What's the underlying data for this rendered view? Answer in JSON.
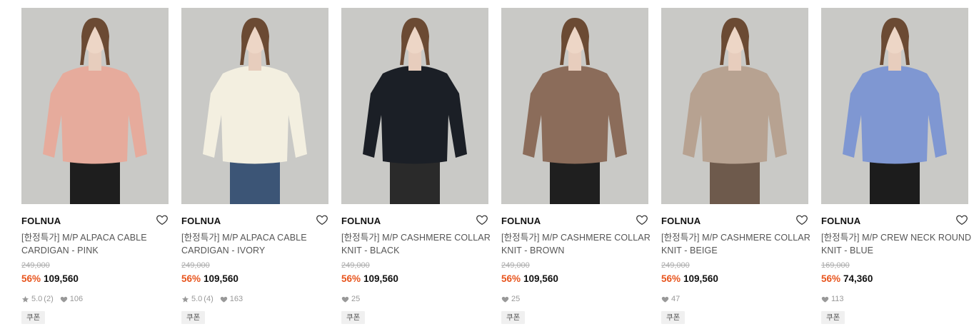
{
  "colors": {
    "discount": "#e8551e",
    "thumb_bg": "#c9c9c6"
  },
  "products": [
    {
      "brand": "FOLNUA",
      "name": "[한정특가] M/P ALPACA CABLE CARDIGAN - PINK",
      "original_price": "249,000",
      "discount": "56%",
      "price": "109,560",
      "rating": "5.0",
      "review_count": "(2)",
      "likes": "106",
      "coupon": "쿠폰",
      "garment_color": "#e6ab9c",
      "bottom_color": "#1e1e1e",
      "icons": [
        "heart-outline-icon",
        "star-icon",
        "heart-icon"
      ]
    },
    {
      "brand": "FOLNUA",
      "name": "[한정특가] M/P ALPACA CABLE CARDIGAN - IVORY",
      "original_price": "249,000",
      "discount": "56%",
      "price": "109,560",
      "rating": "5.0",
      "review_count": "(4)",
      "likes": "163",
      "coupon": "쿠폰",
      "garment_color": "#f3efe0",
      "bottom_color": "#3c5576",
      "icons": [
        "heart-outline-icon",
        "star-icon",
        "heart-icon"
      ]
    },
    {
      "brand": "FOLNUA",
      "name": "[한정특가] M/P CASHMERE COLLAR KNIT - BLACK",
      "original_price": "249,000",
      "discount": "56%",
      "price": "109,560",
      "rating": "",
      "review_count": "",
      "likes": "25",
      "coupon": "쿠폰",
      "garment_color": "#1b1f26",
      "bottom_color": "#2a2a2a",
      "icons": [
        "heart-outline-icon",
        "heart-icon"
      ]
    },
    {
      "brand": "FOLNUA",
      "name": "[한정특가] M/P CASHMERE COLLAR KNIT - BROWN",
      "original_price": "249,000",
      "discount": "56%",
      "price": "109,560",
      "rating": "",
      "review_count": "",
      "likes": "25",
      "coupon": "쿠폰",
      "garment_color": "#8b6c5a",
      "bottom_color": "#1f1f1f",
      "icons": [
        "heart-outline-icon",
        "heart-icon"
      ]
    },
    {
      "brand": "FOLNUA",
      "name": "[한정특가] M/P CASHMERE COLLAR KNIT - BEIGE",
      "original_price": "249,000",
      "discount": "56%",
      "price": "109,560",
      "rating": "",
      "review_count": "",
      "likes": "47",
      "coupon": "쿠폰",
      "garment_color": "#b7a291",
      "bottom_color": "#6e5a4c",
      "icons": [
        "heart-outline-icon",
        "heart-icon"
      ]
    },
    {
      "brand": "FOLNUA",
      "name": "[한정특가] M/P CREW NECK ROUND KNIT - BLUE",
      "original_price": "169,000",
      "discount": "56%",
      "price": "74,360",
      "rating": "",
      "review_count": "",
      "likes": "113",
      "coupon": "쿠폰",
      "garment_color": "#7f97d2",
      "bottom_color": "#1c1c1c",
      "icons": [
        "heart-outline-icon",
        "heart-icon"
      ]
    }
  ]
}
